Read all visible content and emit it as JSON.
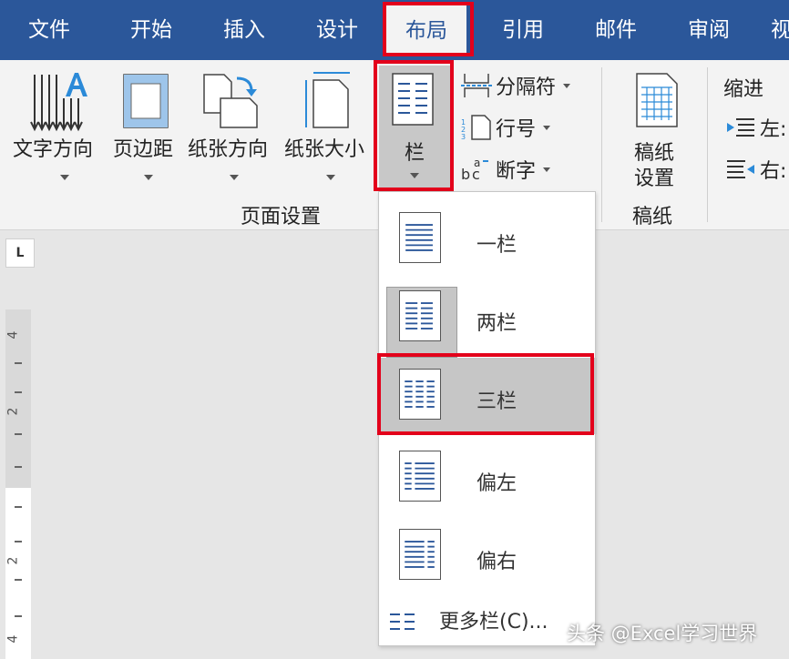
{
  "tabs": [
    {
      "label": "文件"
    },
    {
      "label": "开始"
    },
    {
      "label": "插入"
    },
    {
      "label": "设计"
    },
    {
      "label": "布局",
      "active": true
    },
    {
      "label": "引用"
    },
    {
      "label": "邮件"
    },
    {
      "label": "审阅"
    },
    {
      "label": "视"
    }
  ],
  "ribbon": {
    "page_setup": {
      "text_direction": "文字方向",
      "margins": "页边距",
      "orientation": "纸张方向",
      "size": "纸张大小",
      "columns": "栏",
      "breaks": "分隔符",
      "line_numbers": "行号",
      "hyphenation": "断字",
      "group_label": "页面设置"
    },
    "manuscript": {
      "button_line1": "稿纸",
      "button_line2": "设置",
      "group_label": "稿纸"
    },
    "indent": {
      "header": "缩进",
      "left": "左:",
      "right": "右:"
    }
  },
  "ruler": {
    "corner_glyph": "L",
    "numbers": [
      "4",
      "2",
      "2",
      "4"
    ]
  },
  "columns_menu": {
    "items": [
      {
        "label": "一栏",
        "cols": 1
      },
      {
        "label": "两栏",
        "cols": 2
      },
      {
        "label": "三栏",
        "cols": 3
      },
      {
        "label": "偏左",
        "cols": 2
      },
      {
        "label": "偏右",
        "cols": 2
      }
    ],
    "more": "更多栏(C)..."
  },
  "watermark": "头条 @Excel学习世界",
  "colors": {
    "tab_bar": "#2b579a",
    "highlight_red": "#e3001b",
    "selected_item": "#c6c6c6",
    "icon_blue": "#2b579a"
  }
}
